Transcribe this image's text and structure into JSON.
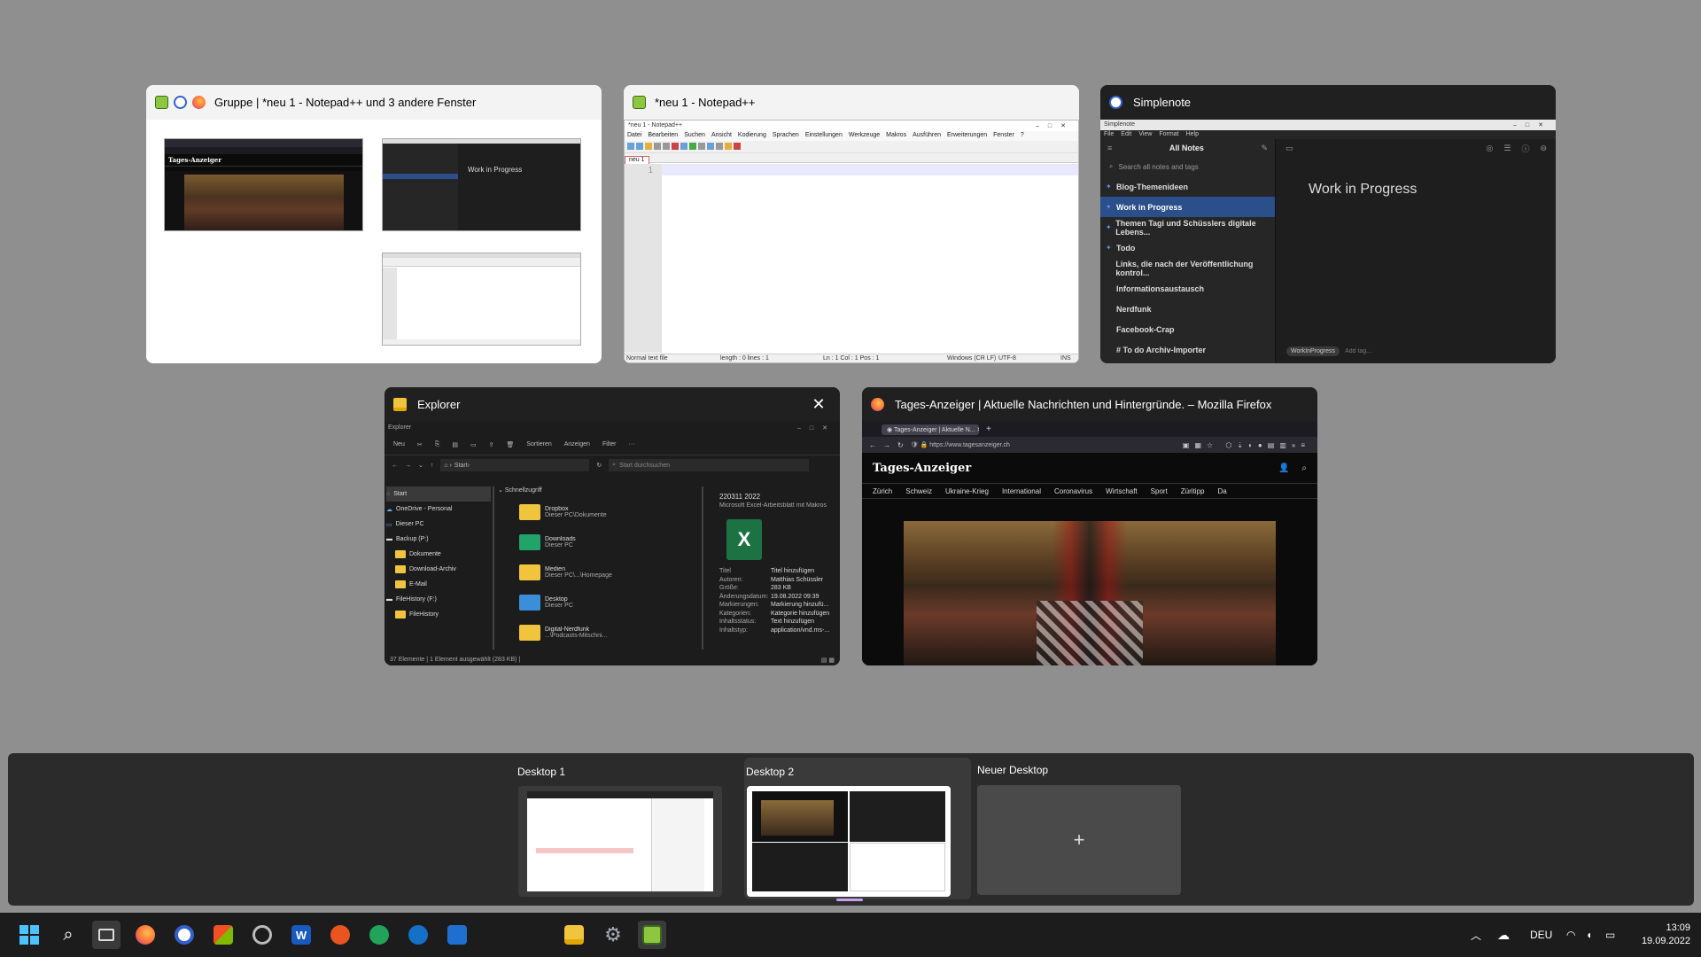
{
  "windows": {
    "group": {
      "title": "Gruppe | *neu 1 - Notepad++ und 3 andere Fenster"
    },
    "notepad": {
      "title": "*neu 1 - Notepad++",
      "inner_title": "*neu 1 - Notepad++",
      "menu": [
        "Datei",
        "Bearbeiten",
        "Suchen",
        "Ansicht",
        "Kodierung",
        "Sprachen",
        "Einstellungen",
        "Werkzeuge",
        "Makros",
        "Ausführen",
        "Erweiterungen",
        "Fenster",
        "?"
      ],
      "tab": "neu 1",
      "line_no": "1",
      "status": [
        "Normal text file",
        "length : 0    lines : 1",
        "Ln : 1    Col : 1    Pos : 1",
        "Windows (CR LF)",
        "UTF-8",
        "INS"
      ]
    },
    "simplenote": {
      "title": "Simplenote",
      "inner_title": "Simplenote",
      "menu": [
        "File",
        "Edit",
        "View",
        "Format",
        "Help"
      ],
      "header": "All Notes",
      "search_placeholder": "Search all notes and tags",
      "notes": [
        {
          "label": "Blog-Themenideen",
          "pinned": true
        },
        {
          "label": "Work in Progress",
          "pinned": true
        },
        {
          "label": "Themen Tagi und Schüsslers digitale Lebens...",
          "pinned": true
        },
        {
          "label": "Todo",
          "pinned": true
        },
        {
          "label": "Links, die nach der Veröffentlichung kontrol...",
          "pinned": false
        },
        {
          "label": "Informationsaustausch",
          "pinned": false
        },
        {
          "label": "Nerdfunk",
          "pinned": false
        },
        {
          "label": "Facebook-Crap",
          "pinned": false
        },
        {
          "label": "# To do Archiv-Importer",
          "pinned": false
        }
      ],
      "editor_text": "Work in Progress",
      "tag": "WorkInProgress",
      "add_tag": "Add tag..."
    },
    "explorer": {
      "title": "Explorer",
      "inner_title": "Explorer",
      "toolbar": [
        "Neu",
        "Sortieren",
        "Anzeigen",
        "Filter",
        "···"
      ],
      "address": "Start",
      "search_placeholder": "Start durchsuchen",
      "tree": [
        "Start",
        "OneDrive - Personal",
        "Dieser PC",
        "Backup (P:)",
        "Dokumente",
        "Download-Archiv",
        "E-Mail",
        "FileHistory (F:)",
        "FileHistory"
      ],
      "quick_access": "Schnellzugriff",
      "items": [
        {
          "name": "Dropbox",
          "sub": "Dieser PC\\Dokumente"
        },
        {
          "name": "Downloads",
          "sub": "Dieser PC"
        },
        {
          "name": "Medien",
          "sub": "Dieser PC\\...\\Homepage"
        },
        {
          "name": "Desktop",
          "sub": "Dieser PC"
        },
        {
          "name": "Digital-Nerdfunk",
          "sub": "...\\Podcasts-Mitschni..."
        }
      ],
      "detail_title": "220311 2022",
      "detail_sub": "Microsoft Excel-Arbeitsblatt mit Makros",
      "props": [
        [
          "Titel",
          "Titel hinzufügen"
        ],
        [
          "Autoren:",
          "Matthias Schüssler"
        ],
        [
          "Größe:",
          "283 KB"
        ],
        [
          "Änderungsdatum:",
          "19.08.2022 09:39"
        ],
        [
          "Markierungen:",
          "Markierung hinzufü..."
        ],
        [
          "Kategorien:",
          "Kategorie hinzufügen"
        ],
        [
          "Inhaltsstatus:",
          "Text hinzufügen"
        ],
        [
          "Inhaltstyp:",
          "application/vnd.ms-..."
        ]
      ],
      "status": "37 Elemente  |  1 Element ausgewählt (283 KB)  |"
    },
    "firefox": {
      "title": "Tages-Anzeiger | Aktuelle Nachrichten und Hintergründe. – Mozilla Firefox",
      "tab": "Tages-Anzeiger | Aktuelle N...",
      "url": "https://www.tagesanzeiger.ch",
      "logo": "Tages-Anzeiger",
      "nav": [
        "Zürich",
        "Schweiz",
        "Ukraine-Krieg",
        "International",
        "Coronavirus",
        "Wirtschaft",
        "Sport",
        "Züritipp",
        "Da"
      ]
    }
  },
  "desktops": {
    "items": [
      {
        "label": "Desktop 1"
      },
      {
        "label": "Desktop 2"
      }
    ],
    "new_label": "Neuer Desktop",
    "new_symbol": "+"
  },
  "taskbar": {
    "lang": "DEU",
    "time": "13:09",
    "date": "19.09.2022",
    "icons": [
      "start-icon",
      "search-icon",
      "task-view-icon",
      "firefox-icon",
      "simplenote-icon",
      "store-icon",
      "keepass-icon",
      "word-icon",
      "ubuntu-icon",
      "chat-icon",
      "teams-icon",
      "calendar-icon",
      "explorer-icon",
      "settings-icon",
      "notepad-icon"
    ]
  },
  "colors": {
    "background": "#8f8f8f",
    "accent_blue": "#2a4f8a",
    "taskbar": "#1c1c1c"
  }
}
